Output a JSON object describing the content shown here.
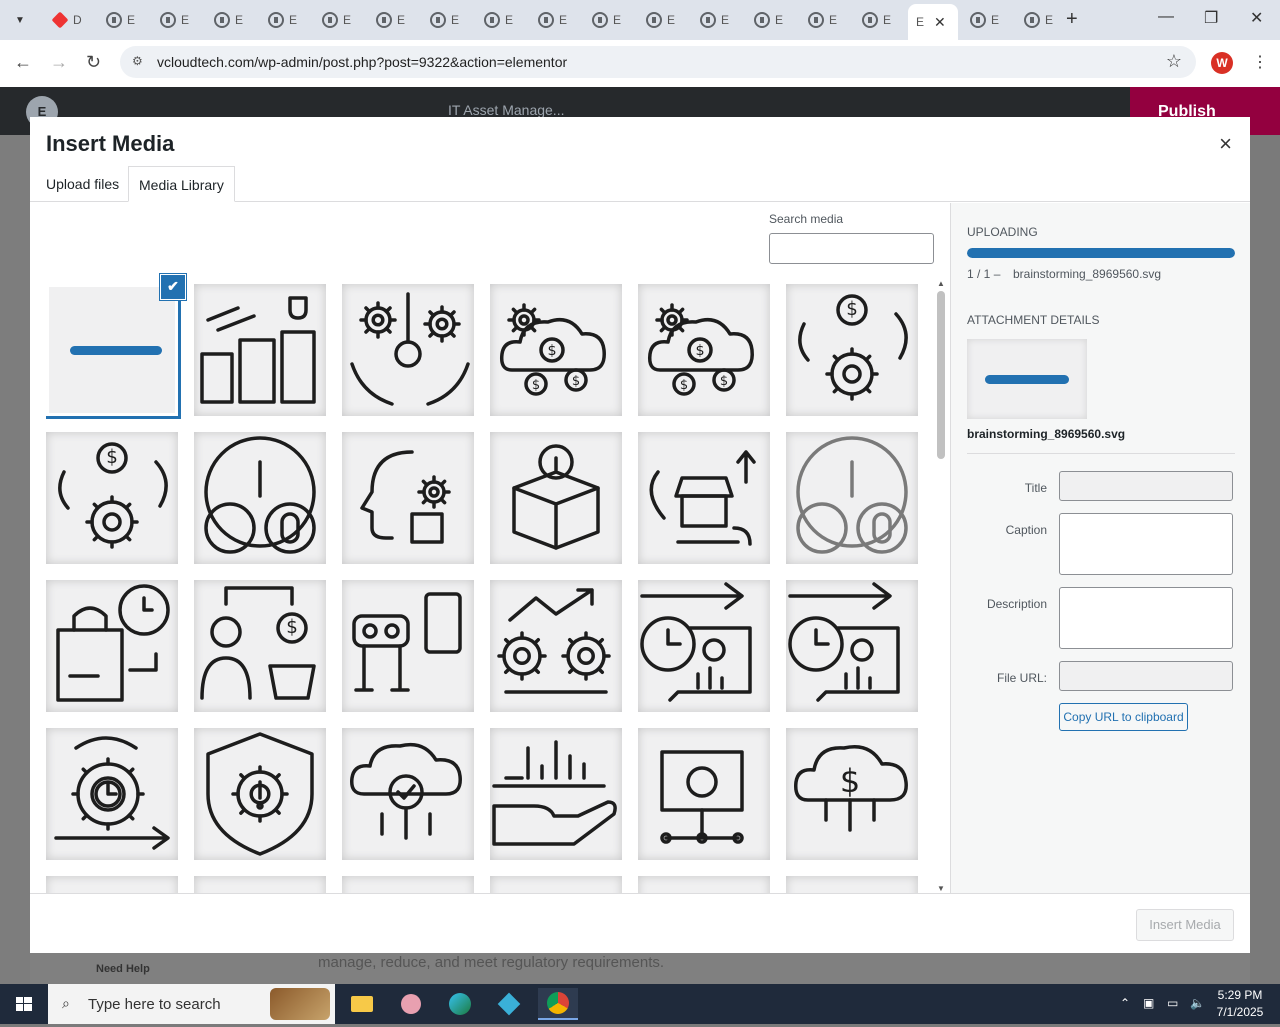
{
  "browser": {
    "tabs": [
      {
        "label": "D",
        "icon": "elementor-red-icon"
      },
      {
        "label": "E",
        "icon": "wordpress-icon"
      },
      {
        "label": "E",
        "icon": "wordpress-icon"
      },
      {
        "label": "E",
        "icon": "wordpress-icon"
      },
      {
        "label": "E",
        "icon": "wordpress-icon"
      },
      {
        "label": "E",
        "icon": "wordpress-icon"
      },
      {
        "label": "E",
        "icon": "wordpress-icon"
      },
      {
        "label": "E",
        "icon": "wordpress-icon"
      },
      {
        "label": "E",
        "icon": "wordpress-icon"
      },
      {
        "label": "E",
        "icon": "wordpress-icon"
      },
      {
        "label": "E",
        "icon": "wordpress-icon"
      },
      {
        "label": "E",
        "icon": "wordpress-icon"
      },
      {
        "label": "E",
        "icon": "wordpress-icon"
      },
      {
        "label": "E",
        "icon": "wordpress-icon"
      },
      {
        "label": "E",
        "icon": "wordpress-icon"
      },
      {
        "label": "E",
        "icon": "wordpress-icon"
      },
      {
        "label": "E",
        "icon": "none",
        "active": true
      },
      {
        "label": "E",
        "icon": "wordpress-icon"
      },
      {
        "label": "E",
        "icon": "wordpress-icon"
      }
    ],
    "url": "vcloudtech.com/wp-admin/post.php?post=9322&action=elementor",
    "profile_initial": "W"
  },
  "editor": {
    "logo": "E",
    "document_title": "IT Asset Manage...",
    "publish_label": "Publish",
    "need_help": "Need Help",
    "background_text": "manage, reduce, and meet regulatory requirements."
  },
  "modal": {
    "title": "Insert Media",
    "close": "×",
    "tabs": [
      "Upload files",
      "Media Library"
    ],
    "active_tab": "Media Library",
    "search_label": "Search media",
    "search_value": "",
    "selected_check": "✔",
    "grid_items": [
      "blue-dash",
      "buildings-trophy",
      "hands-key-gears",
      "cloud-gears-coins",
      "cloud-gears-coins",
      "gear-dollar-cycle",
      "gear-dollar-cycle",
      "gauge-heart-pill",
      "head-gear-document",
      "open-box-info",
      "store-cycle-arrows",
      "gauge-heart-pill-gray",
      "shopping-bag-clock",
      "person-dollar-basket",
      "robot-phone-control",
      "gears-growth-chart",
      "clock-chart-arrow",
      "clock-chart-arrow",
      "gear-clock-cycle",
      "shield-gear-alert",
      "cloud-magnifier-check",
      "hand-bar-chart",
      "folder-bug-network",
      "cloud-dollar-network",
      "partial",
      "partial",
      "partial",
      "partial",
      "partial",
      "partial"
    ],
    "sidebar": {
      "uploading_label": "Uploading",
      "progress": 1.0,
      "upload_count": "1 / 1",
      "upload_dash": "–",
      "upload_filename": "brainstorming_8969560.svg",
      "attachment_label": "Attachment Details",
      "attachment_filename": "brainstorming_8969560.svg",
      "fields": {
        "title_label": "Title",
        "caption_label": "Caption",
        "description_label": "Description",
        "file_url_label": "File URL:"
      },
      "copy_button": "Copy URL to clipboard"
    },
    "insert_button": "Insert Media"
  },
  "taskbar": {
    "search_placeholder": "Type here to search",
    "time": "5:29 PM",
    "date": "7/1/2025"
  },
  "colors": {
    "accent": "#2271b1",
    "elementor_dark": "#26292c",
    "publish": "#93003f"
  }
}
